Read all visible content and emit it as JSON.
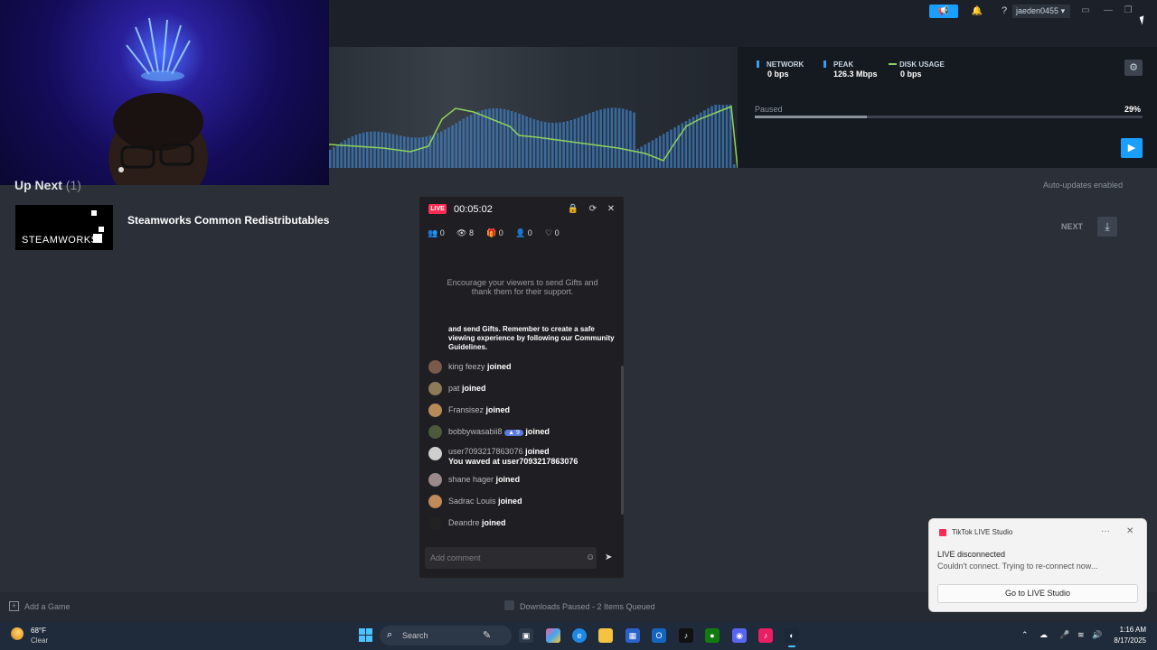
{
  "topbar": {
    "announce_icon": "megaphone-icon",
    "bell_icon": "bell-icon",
    "help_label": "?",
    "username": "jaeden0455",
    "user_caret": "▾",
    "screen_icon": "monitor-icon",
    "minimize_label": "—",
    "restore_label": "❐",
    "close_label": "✕",
    "accent": "#1a9fff"
  },
  "download_graph": {
    "legend": [
      {
        "label": "NETWORK",
        "value": "0 bps",
        "color": "#3d9be9"
      },
      {
        "label": "PEAK",
        "value": "126.3 Mbps",
        "color": "#3d9be9"
      },
      {
        "label": "DISK USAGE",
        "value": "0 bps",
        "color": "#8ed25b"
      }
    ],
    "status": "Paused",
    "percent": "29%",
    "progress": 0.29,
    "settings_icon": "gear-icon",
    "play_icon": "play-icon"
  },
  "up_next": {
    "title": "Up Next",
    "count": "(1)",
    "auto_updates": "Auto-updates enabled",
    "item": {
      "logo_text": "STEAMWORKS",
      "name": "Steamworks Common Redistributables",
      "next_label": "NEXT",
      "download_icon": "download-icon"
    }
  },
  "tiktok_panel": {
    "live_badge": "LIVE",
    "timer": "00:05:02",
    "lock_icon": "lock-icon",
    "refresh_icon": "refresh-icon",
    "close_label": "✕",
    "stats": [
      {
        "icon": "viewers-icon",
        "glyph": "👥",
        "value": "0"
      },
      {
        "icon": "eye-icon",
        "glyph": "👁",
        "value": "8"
      },
      {
        "icon": "gift-icon",
        "glyph": "🎁",
        "value": "0"
      },
      {
        "icon": "follow-icon",
        "glyph": "👤",
        "value": "0"
      },
      {
        "icon": "heart-icon",
        "glyph": "♡",
        "value": "0"
      }
    ],
    "encourage": "Encourage your viewers to send Gifts and thank them for their support.",
    "guideline": "and send Gifts. Remember to create a safe viewing experience by following our Community Guidelines.",
    "chat": [
      {
        "name": "king feezy",
        "action": "joined",
        "extra": ""
      },
      {
        "name": "pat",
        "action": "joined",
        "extra": ""
      },
      {
        "name": "Fransisez",
        "action": "joined",
        "extra": ""
      },
      {
        "name": "bobbywasabii8",
        "badge": "9",
        "action": "joined",
        "extra": ""
      },
      {
        "name": "user7093217863076",
        "action": "joined",
        "extra": "You waved at user7093217863076"
      },
      {
        "name": "shane hager",
        "action": "joined",
        "extra": ""
      },
      {
        "name": "Sadrac Louis",
        "action": "joined",
        "extra": ""
      },
      {
        "name": "Deandre",
        "action": "joined",
        "extra": ""
      }
    ],
    "comment_placeholder": "Add comment",
    "emoji_icon": "emoji-icon",
    "send_icon": "send-icon"
  },
  "statusbar": {
    "add_game": "Add a Game",
    "downloads": "Downloads Paused - 2 Items Queued"
  },
  "toast": {
    "app": "TikTok LIVE Studio",
    "more_label": "···",
    "close_label": "✕",
    "title": "LIVE disconnected",
    "body": "Couldn't connect. Trying to re-connect now...",
    "button": "Go to LIVE Studio"
  },
  "taskbar": {
    "weather_temp": "68°F",
    "weather_desc": "Clear",
    "search_label": "Search",
    "time": "1:16 AM",
    "date": "8/17/2025"
  }
}
